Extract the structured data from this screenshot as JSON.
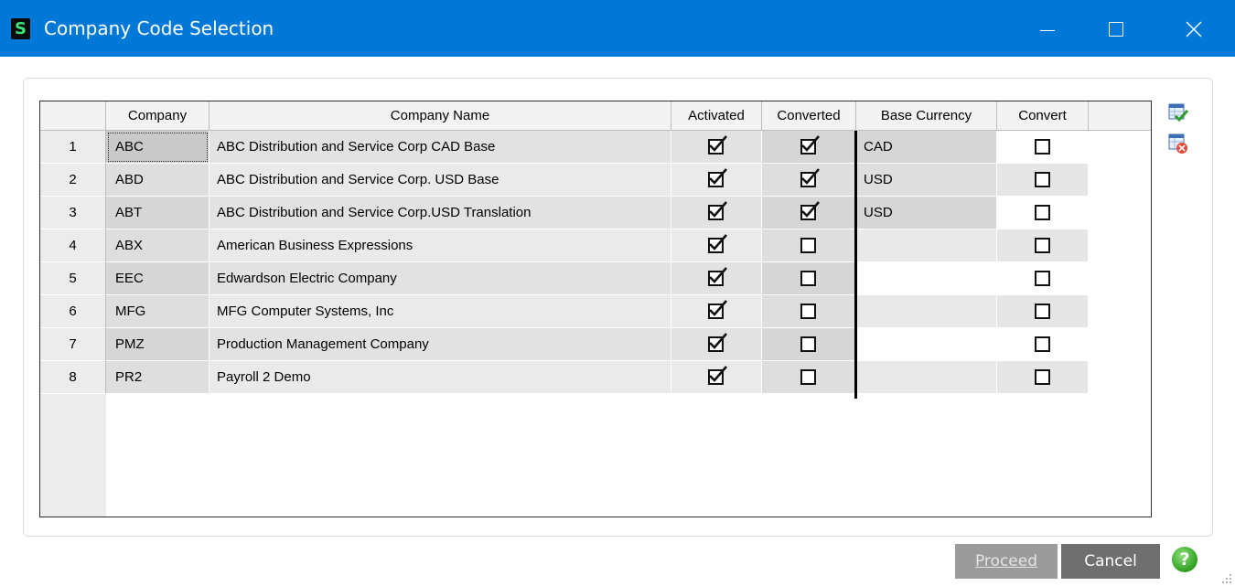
{
  "window": {
    "title": "Company Code Selection",
    "app_icon_letter": "S"
  },
  "grid": {
    "columns": [
      "Company",
      "Company Name",
      "Activated",
      "Converted",
      "Base Currency",
      "Convert"
    ],
    "rows": [
      {
        "num": "1",
        "company": "ABC",
        "name": "ABC Distribution and Service Corp CAD Base",
        "activated": true,
        "converted": true,
        "currency": "CAD",
        "convert": false
      },
      {
        "num": "2",
        "company": "ABD",
        "name": "ABC Distribution and Service Corp. USD Base",
        "activated": true,
        "converted": true,
        "currency": "USD",
        "convert": false
      },
      {
        "num": "3",
        "company": "ABT",
        "name": "ABC Distribution and Service Corp.USD Translation",
        "activated": true,
        "converted": true,
        "currency": "USD",
        "convert": false
      },
      {
        "num": "4",
        "company": "ABX",
        "name": "American Business Expressions",
        "activated": true,
        "converted": false,
        "currency": "",
        "convert": false
      },
      {
        "num": "5",
        "company": "EEC",
        "name": "Edwardson Electric Company",
        "activated": true,
        "converted": false,
        "currency": "",
        "convert": false
      },
      {
        "num": "6",
        "company": "MFG",
        "name": "MFG Computer Systems, Inc",
        "activated": true,
        "converted": false,
        "currency": "",
        "convert": false
      },
      {
        "num": "7",
        "company": "PMZ",
        "name": "Production Management Company",
        "activated": true,
        "converted": false,
        "currency": "",
        "convert": false
      },
      {
        "num": "8",
        "company": "PR2",
        "name": "Payroll 2 Demo",
        "activated": true,
        "converted": false,
        "currency": "",
        "convert": false
      }
    ]
  },
  "side_icons": [
    "select-all-icon",
    "clear-all-icon"
  ],
  "buttons": {
    "proceed": "Proceed",
    "cancel": "Cancel"
  },
  "help_icon": "?",
  "colors": {
    "titlebar": "#0078d7",
    "row_light": "#ececec",
    "row_dark": "#d6d6d6",
    "check_green": "#2a9c2a"
  }
}
